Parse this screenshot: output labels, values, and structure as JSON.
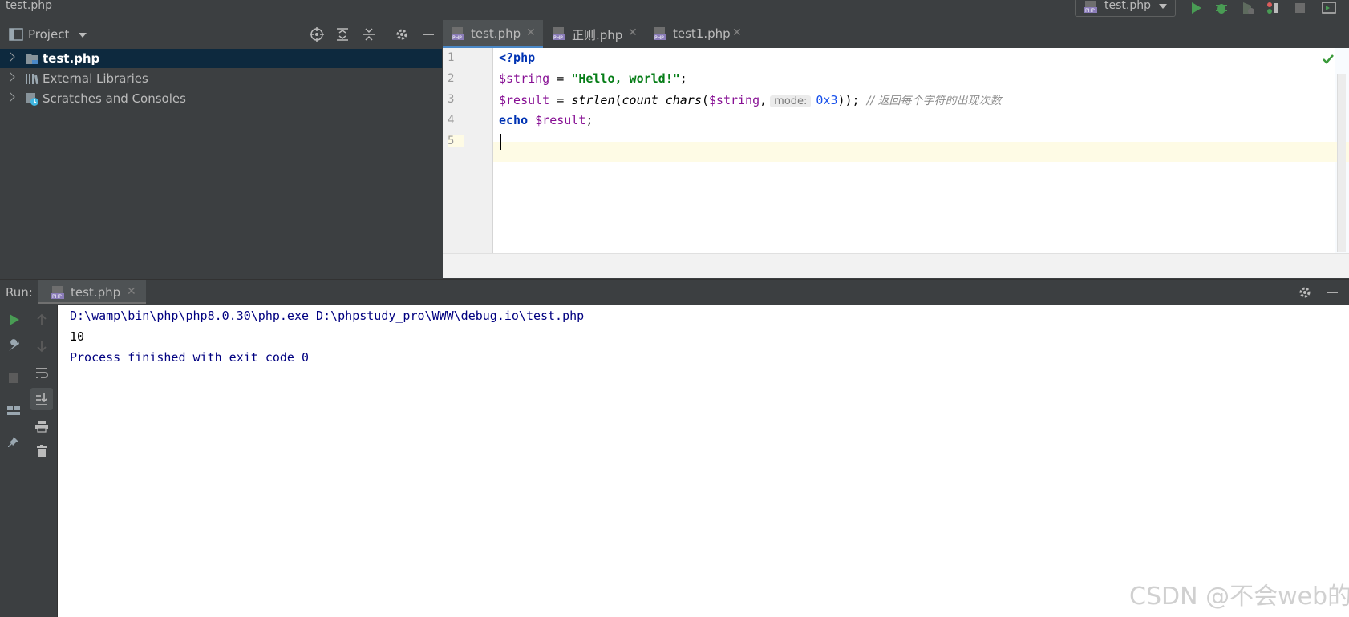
{
  "window": {
    "title": "test.php"
  },
  "toolbar": {
    "run_config": "test.php"
  },
  "project_panel": {
    "title": "Project",
    "tree": [
      {
        "label": "test.php",
        "selected": true
      },
      {
        "label": "External Libraries",
        "selected": false
      },
      {
        "label": "Scratches and Consoles",
        "selected": false
      }
    ]
  },
  "editor": {
    "tabs": [
      {
        "label": "test.php",
        "active": true
      },
      {
        "label": "正则.php",
        "active": false
      },
      {
        "label": "test1.php",
        "active": false
      }
    ],
    "line_numbers": [
      "1",
      "2",
      "3",
      "4",
      "5"
    ],
    "code": {
      "l1_open": "<?php",
      "l2_var": "$string",
      "l2_eq": " = ",
      "l2_str": "\"Hello, world!\"",
      "l2_end": ";",
      "l3_var": "$result",
      "l3_eq": " = ",
      "l3_fn1": "strlen",
      "l3_p1": "(",
      "l3_fn2": "count_chars",
      "l3_p2": "(",
      "l3_arg": "$string",
      "l3_comma": ",",
      "l3_hint": "mode:",
      "l3_num": "0x3",
      "l3_close": ")); ",
      "l3_comment": "// 返回每个字符的出现次数",
      "l4_kw": "echo",
      "l4_sp": " ",
      "l4_var": "$result",
      "l4_end": ";"
    }
  },
  "run_panel": {
    "label": "Run:",
    "tab": "test.php",
    "console": [
      {
        "text": "D:\\wamp\\bin\\php\\php8.0.30\\php.exe D:\\phpstudy_pro\\WWW\\debug.io\\test.php",
        "kind": "system"
      },
      {
        "text": "10",
        "kind": "output"
      },
      {
        "text": "Process finished with exit code 0",
        "kind": "system"
      }
    ]
  },
  "watermark": "CSDN @不会web的小白",
  "colors": {
    "ide_background": "#3c3f41",
    "selection": "#0d293e",
    "active_tab_underline": "#4a88c7",
    "keyword": "#0033b3",
    "variable": "#871094",
    "string": "#067d17",
    "run_green": "#499c54"
  }
}
